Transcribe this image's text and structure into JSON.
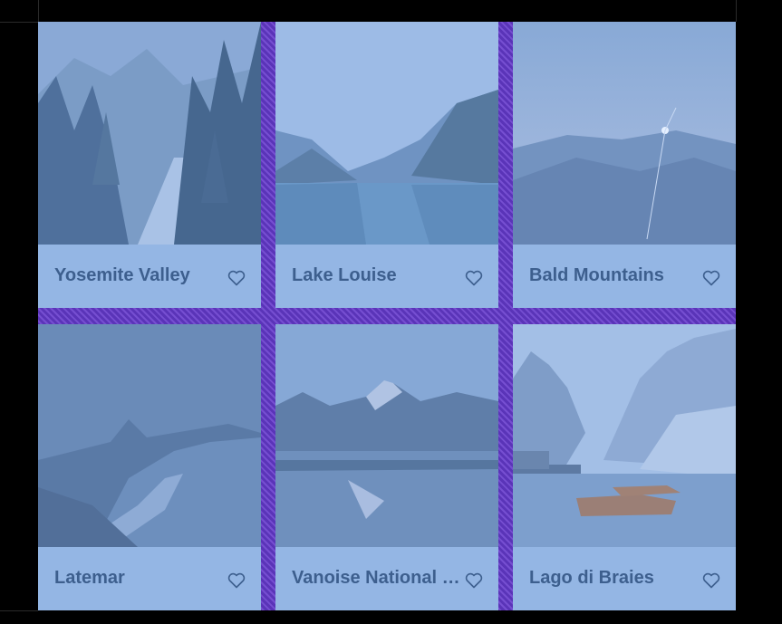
{
  "cards": [
    {
      "title": "Yosemite Valley",
      "icon": "heart-outline-icon"
    },
    {
      "title": "Lake Louise",
      "icon": "heart-outline-icon"
    },
    {
      "title": "Bald Mountains",
      "icon": "heart-outline-icon"
    },
    {
      "title": "Latemar",
      "icon": "heart-outline-icon"
    },
    {
      "title": "Vanoise National Park",
      "icon": "heart-outline-icon"
    },
    {
      "title": "Lago di Braies",
      "icon": "heart-outline-icon"
    }
  ],
  "colors": {
    "background": "#000000",
    "grid_highlight": "#5a34b8",
    "card_overlay": "#94b6e4",
    "title_text": "#3d5f8e"
  }
}
